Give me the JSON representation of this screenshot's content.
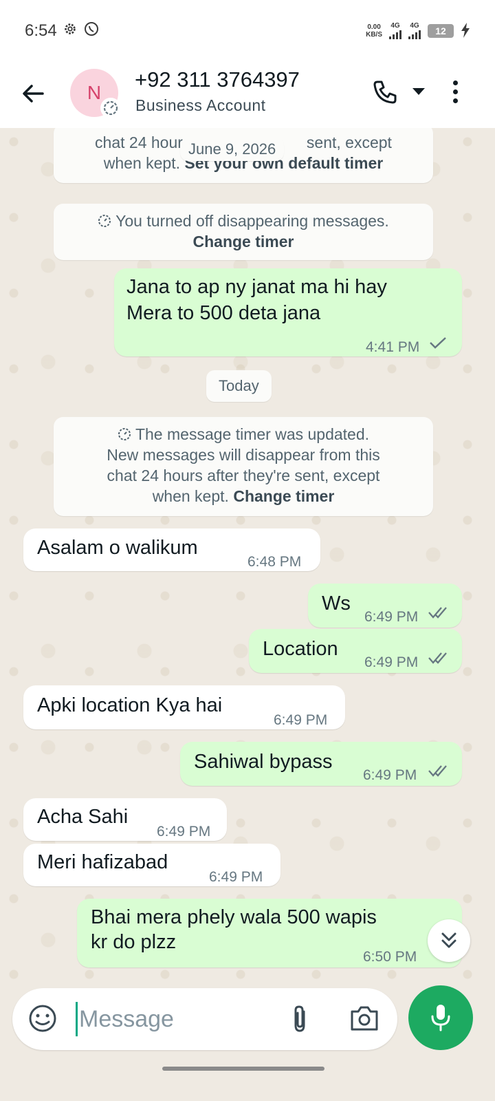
{
  "status_bar": {
    "time": "6:54",
    "net_speed_value": "0.00",
    "net_speed_unit": "KB/S",
    "sim1": "4G",
    "sim2": "4G",
    "battery": "12",
    "icons": [
      "settings-icon",
      "whatsapp-icon",
      "signal-icon",
      "battery-icon",
      "charging-icon"
    ]
  },
  "header": {
    "avatar_letter": "N",
    "contact_name": "+92 311 3764397",
    "subtitle": "Business Account",
    "icons": [
      "back-arrow-icon",
      "disappearing-timer-icon",
      "phone-icon",
      "chevron-down-icon",
      "more-vert-icon"
    ]
  },
  "chat": {
    "system_top": {
      "line1": "chat 24 hour",
      "line1_end": "sent, except",
      "line2": "when kept.",
      "line2_link": "Set your own default timer"
    },
    "date_pill_1": "June 9, 2026",
    "system_off": {
      "text": "You turned off disappearing messages.",
      "link": "Change timer"
    },
    "msg_1": {
      "line1": "Jana to ap ny janat ma hi hay",
      "line2": "Mera to 500 deta jana",
      "time": "4:41 PM",
      "status": "sent"
    },
    "date_pill_2": "Today",
    "system_updated": {
      "line1": "The message timer was updated.",
      "line2": "New messages will disappear from this",
      "line3": "chat 24 hours after they're sent, except",
      "line4": "when kept.",
      "link": "Change timer"
    },
    "msg_2": {
      "text": "Asalam o walikum",
      "time": "6:48 PM"
    },
    "msg_3": {
      "text": "Ws",
      "time": "6:49 PM",
      "status": "delivered"
    },
    "msg_4": {
      "text": "Location",
      "time": "6:49 PM",
      "status": "delivered"
    },
    "msg_5": {
      "text": "Apki location Kya hai",
      "time": "6:49 PM"
    },
    "msg_6": {
      "text": "Sahiwal bypass",
      "time": "6:49 PM",
      "status": "delivered"
    },
    "msg_7": {
      "text": "Acha Sahi",
      "time": "6:49 PM"
    },
    "msg_8": {
      "text": "Meri hafizabad",
      "time": "6:49 PM"
    },
    "msg_9": {
      "line1": "Bhai mera phely wala 500 wapis",
      "line2": "kr do plzz",
      "time": "6:50 PM",
      "status": "sent"
    }
  },
  "composer": {
    "placeholder": "Message",
    "icons": [
      "sticker-icon",
      "attach-icon",
      "camera-icon",
      "mic-icon",
      "scroll-down-icon"
    ]
  },
  "colors": {
    "header_bg": "#ffffff",
    "chat_bg": "#efeae2",
    "outgoing_bubble": "#d9fdd3",
    "incoming_bubble": "#ffffff",
    "accent": "#1daa61"
  }
}
